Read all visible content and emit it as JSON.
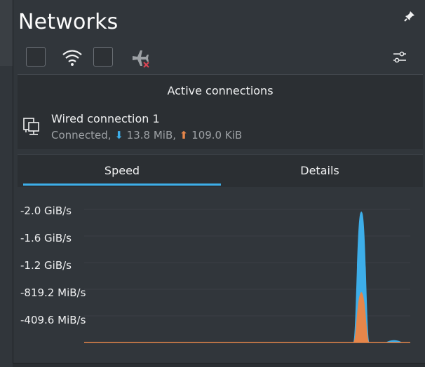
{
  "header": {
    "title": "Networks"
  },
  "toolbar": {
    "items": [
      "checkbox",
      "wifi-icon",
      "checkbox",
      "airplane-mode-off-icon",
      "configure-icon"
    ]
  },
  "active_connections": {
    "label": "Active connections"
  },
  "connection": {
    "name": "Wired connection 1",
    "status_prefix": "Connected, ",
    "down_arrow": "⬇",
    "download": "13.8 MiB",
    "separator": ", ",
    "up_arrow": "⬆",
    "upload": "109.0 KiB"
  },
  "tabs": [
    {
      "label": "Speed",
      "active": true
    },
    {
      "label": "Details",
      "active": false
    }
  ],
  "colors": {
    "download": "#3daee9",
    "upload": "#e6864a",
    "accent": "#3daee9"
  },
  "chart_data": {
    "type": "area",
    "ytick_labels": [
      "-2.0 GiB/s",
      "-1.6 GiB/s",
      "-1.2 GiB/s",
      "-819.2 MiB/s",
      "-409.6 MiB/s"
    ],
    "ytick_values_mib": [
      -2048,
      -1638.4,
      -1228.8,
      -819.2,
      -409.6
    ],
    "x": [
      0,
      1,
      2,
      3,
      4,
      5,
      6,
      7,
      8,
      9,
      10,
      11,
      12,
      13,
      14,
      15,
      16,
      17,
      18,
      19,
      20
    ],
    "series": [
      {
        "color": "#3daee9",
        "values_mib": [
          0,
          0,
          0,
          0,
          0,
          0,
          0,
          0,
          0,
          0,
          0,
          0,
          0,
          0,
          0,
          0,
          0,
          2000,
          0,
          0,
          0
        ]
      },
      {
        "color": "#e6864a",
        "values_mib": [
          0,
          0,
          0,
          0,
          0,
          0,
          0,
          0,
          0,
          0,
          0,
          0,
          0,
          0,
          0,
          0,
          0,
          760,
          0,
          0,
          0
        ]
      }
    ],
    "small_bump": {
      "x": 19,
      "value_mib": 30
    },
    "grid": true
  }
}
